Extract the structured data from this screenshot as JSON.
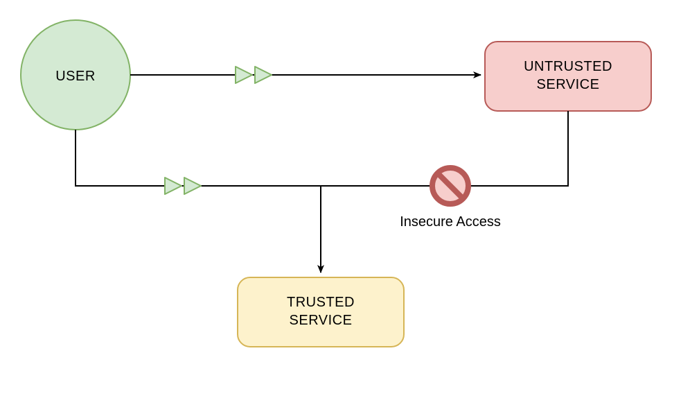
{
  "nodes": {
    "user": {
      "label": "USER",
      "fill": "#d4ead3",
      "stroke": "#82b366"
    },
    "untrusted": {
      "label_line1": "UNTRUSTED",
      "label_line2": "SERVICE",
      "fill": "#f7cecc",
      "stroke": "#b75a57"
    },
    "trusted": {
      "label_line1": "TRUSTED",
      "label_line2": "SERVICE",
      "fill": "#fdf2cc",
      "stroke": "#d6b556"
    }
  },
  "annotations": {
    "insecure": "Insecure Access"
  },
  "colors": {
    "arrow_green_fill": "#d4ead3",
    "arrow_green_stroke": "#82b366",
    "prohibit_fill": "#f7cecc",
    "prohibit_stroke": "#b75a57",
    "line": "#000000"
  }
}
